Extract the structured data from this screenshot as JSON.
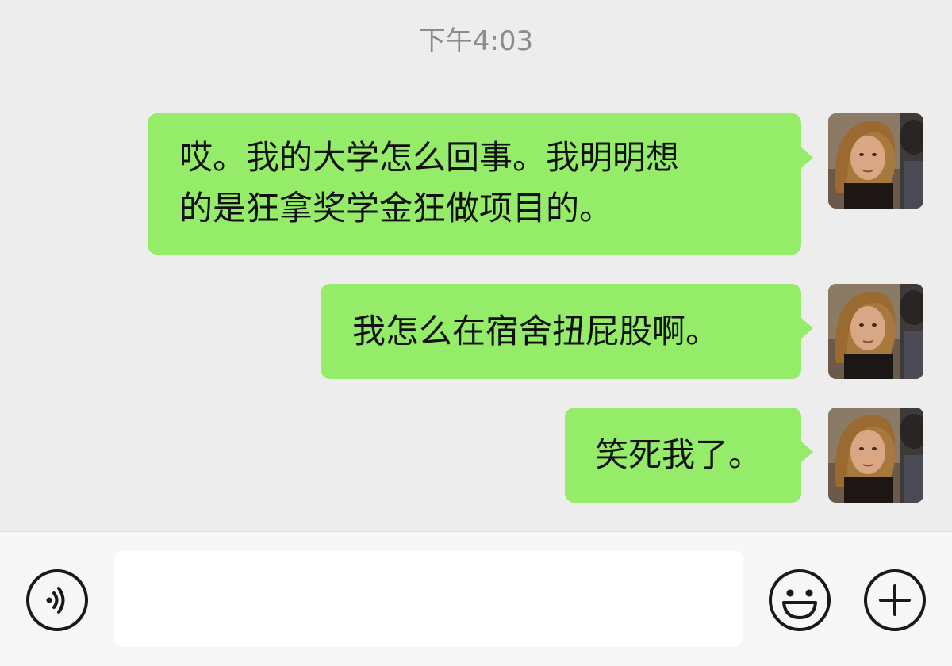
{
  "chat": {
    "timestamp": "下午4:03",
    "messages": [
      {
        "line1": "哎。我的大学怎么回事。我明明想",
        "line2": "的是狂拿奖学金狂做项目的。"
      },
      {
        "line1": "我怎么在宿舍扭屁股啊。"
      },
      {
        "line1": "笑死我了。"
      }
    ]
  },
  "input_bar": {
    "voice_icon": "voice-icon",
    "text_value": "",
    "emoji_icon": "emoji-icon",
    "plus_icon": "plus-icon"
  },
  "colors": {
    "background": "#ededed",
    "bubble": "#95ec69",
    "input_bar": "#f7f7f7"
  }
}
